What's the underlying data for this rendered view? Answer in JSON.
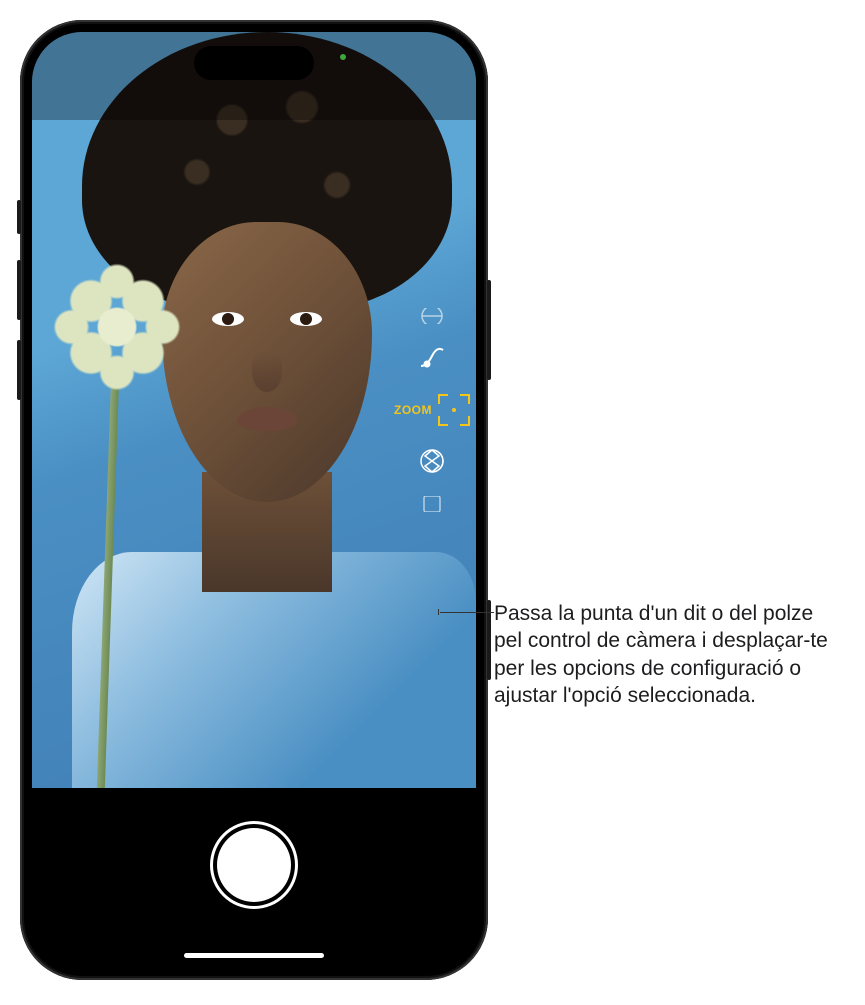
{
  "camera": {
    "zoom_label": "ZOOM",
    "controls": {
      "depth_icon": "depth-curve-icon",
      "frame_icon": "frame-focus-icon",
      "styles_icon": "photographic-styles-icon"
    }
  },
  "callout": {
    "text": "Passa la punta d'un dit o del polze pel control de càmera i desplaçar-te per les opcions de configuració o ajustar l'opció seleccionada."
  }
}
